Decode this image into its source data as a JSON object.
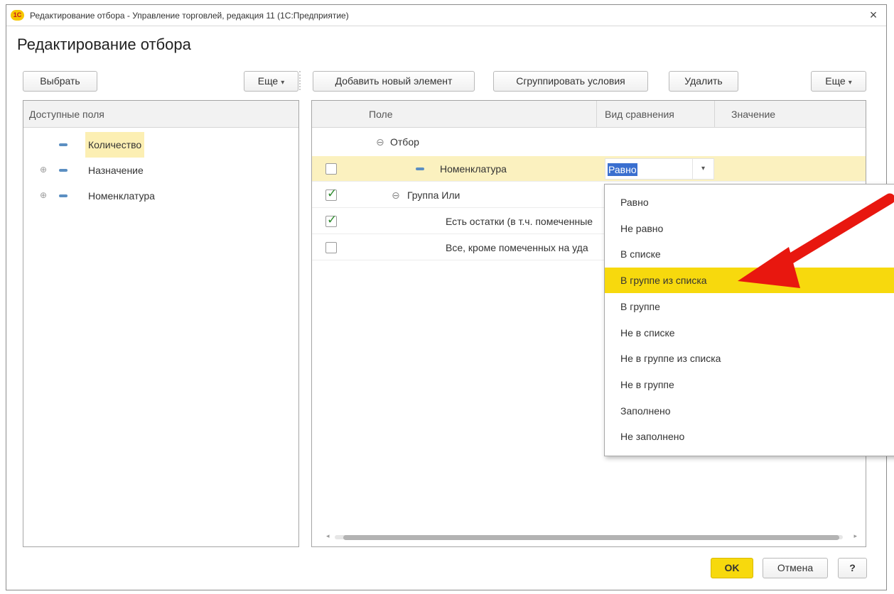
{
  "window": {
    "app_logo": "1С",
    "title": "Редактирование отбора - Управление торговлей, редакция 11  (1С:Предприятие)",
    "close_glyph": "×"
  },
  "page_title": "Редактирование отбора",
  "left_toolbar": {
    "choose": "Выбрать",
    "more": "Еще"
  },
  "right_toolbar": {
    "add": "Добавить новый элемент",
    "group": "Сгруппировать условия",
    "delete": "Удалить",
    "more": "Еще"
  },
  "available_fields": {
    "header": "Доступные поля",
    "items": [
      {
        "label": "Количество",
        "expandable": false,
        "highlighted": true
      },
      {
        "label": "Назначение",
        "expandable": true
      },
      {
        "label": "Номенклатура",
        "expandable": true
      }
    ]
  },
  "filter_table": {
    "columns": {
      "field": "Поле",
      "comparison": "Вид сравнения",
      "value": "Значение"
    },
    "rows": [
      {
        "field": "Отбор",
        "type": "group-root"
      },
      {
        "field": "Номенклатура",
        "comparison": "Равно",
        "checked": false,
        "selected": true
      },
      {
        "field": "Группа Или",
        "type": "group",
        "checked": true
      },
      {
        "field": "Есть остатки (в т.ч. помеченные",
        "checked": true
      },
      {
        "field": "Все, кроме помеченных на уда",
        "checked": false
      }
    ]
  },
  "comparison_dropdown": {
    "options": [
      "Равно",
      "Не равно",
      "В списке",
      "В группе из списка",
      "В группе",
      "Не в списке",
      "Не в группе из списка",
      "Не в группе",
      "Заполнено",
      "Не заполнено"
    ],
    "highlighted": "В группе из списка"
  },
  "footer": {
    "ok": "OK",
    "cancel": "Отмена",
    "help": "?"
  },
  "colors": {
    "highlight": "#f7d90d",
    "selection": "#3a6fcf",
    "annotation_arrow": "#e8170f"
  },
  "icons": [
    "close-icon",
    "tree-expand-icon",
    "field-icon",
    "group-collapse-icon",
    "checkbox-checked-icon",
    "checkbox-empty-icon",
    "dropdown-caret-icon"
  ]
}
